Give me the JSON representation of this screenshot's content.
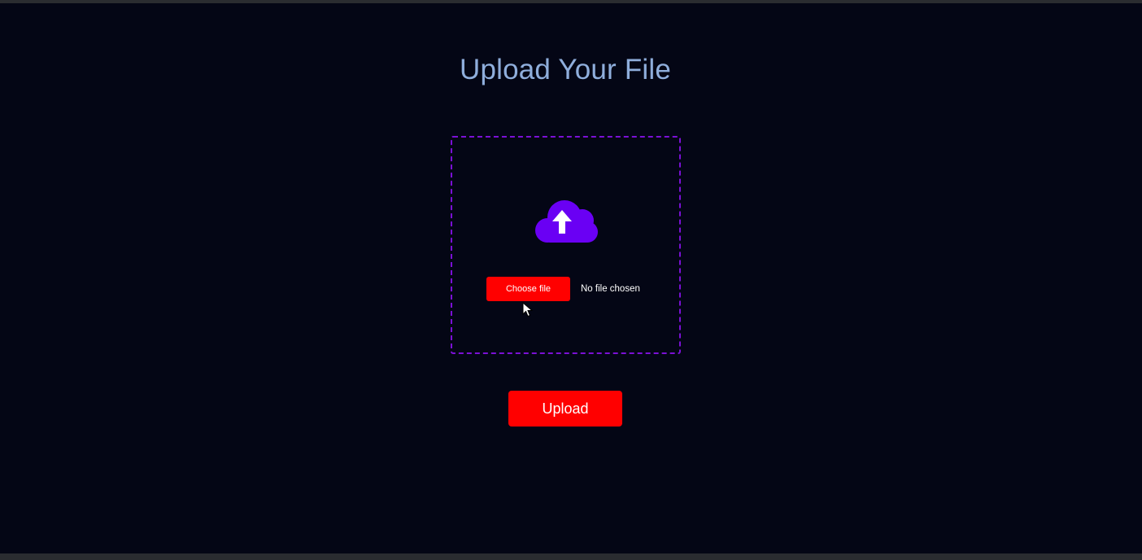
{
  "page": {
    "title": "Upload Your File"
  },
  "dropzone": {
    "icon": "cloud-upload-icon",
    "choose_file_label": "Choose file",
    "file_status": "No file chosen"
  },
  "actions": {
    "upload_label": "Upload"
  },
  "colors": {
    "background": "#040615",
    "title": "#8faedc",
    "dropzone_border": "#7b10d6",
    "icon": "#6a00f4",
    "button": "#ff0000",
    "button_text": "#ffffff"
  }
}
